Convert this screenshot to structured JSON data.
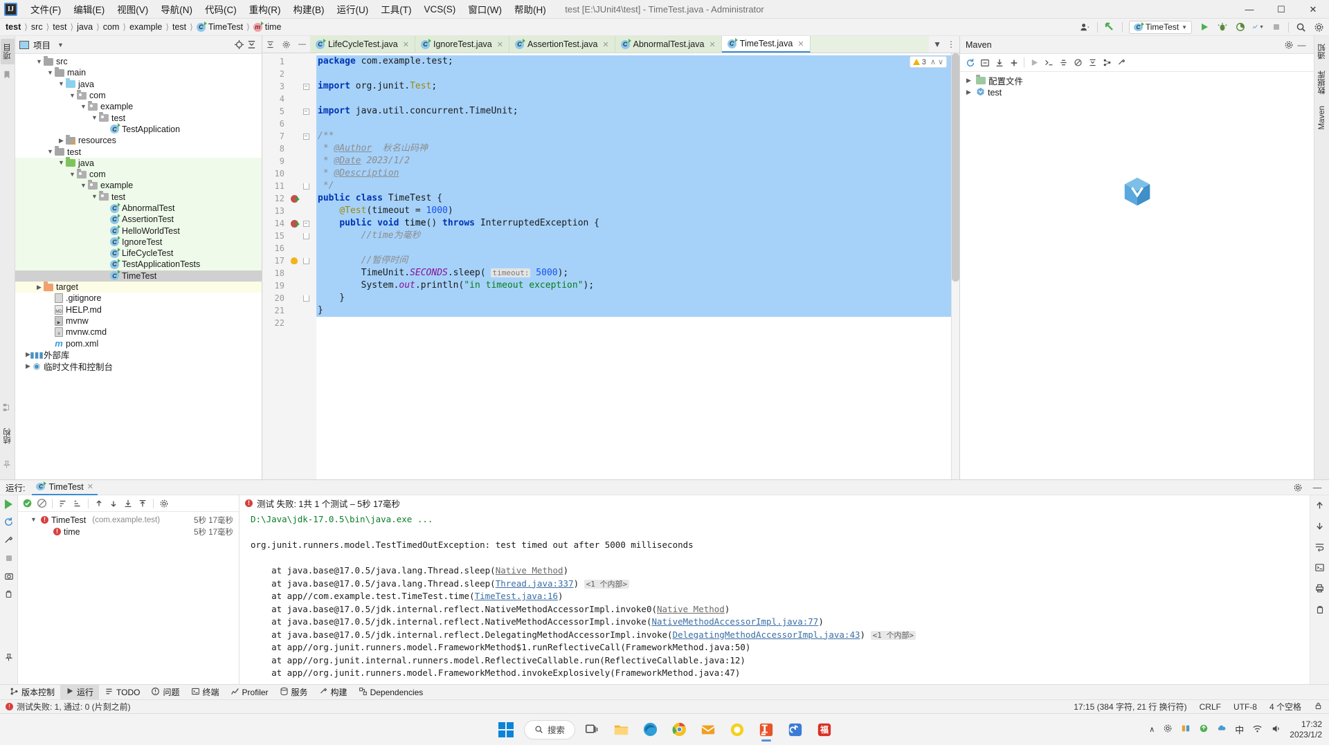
{
  "window": {
    "title": "test [E:\\JUnit4\\test] - TimeTest.java - Administrator",
    "logo": "IJ",
    "minimize": "—",
    "maximize": "☐",
    "close": "✕"
  },
  "menubar": [
    {
      "label": "文件(F)"
    },
    {
      "label": "编辑(E)"
    },
    {
      "label": "视图(V)"
    },
    {
      "label": "导航(N)"
    },
    {
      "label": "代码(C)"
    },
    {
      "label": "重构(R)"
    },
    {
      "label": "构建(B)"
    },
    {
      "label": "运行(U)"
    },
    {
      "label": "工具(T)"
    },
    {
      "label": "VCS(S)"
    },
    {
      "label": "窗口(W)"
    },
    {
      "label": "帮助(H)"
    }
  ],
  "breadcrumb": [
    {
      "label": "test",
      "bold": true
    },
    {
      "label": "src"
    },
    {
      "label": "test"
    },
    {
      "label": "java"
    },
    {
      "label": "com"
    },
    {
      "label": "example"
    },
    {
      "label": "test"
    },
    {
      "label": "TimeTest",
      "icon": "class-icon"
    },
    {
      "label": "time",
      "icon": "method-icon"
    }
  ],
  "toolbar_right": {
    "run_config": "TimeTest",
    "search_icon": "search-icon",
    "settings_icon": "gear-icon",
    "run_icon": "run-icon",
    "debug_icon": "debug-icon",
    "coverage_icon": "coverage-icon",
    "stop_icon": "stop-icon"
  },
  "project_panel": {
    "title": "项目",
    "locate_icon": "locate-icon",
    "collapse_icon": "collapse-all-icon",
    "settings_icon": "gear-icon",
    "hide_icon": "hide-icon",
    "tree": [
      {
        "label": "src",
        "indent": 1,
        "arrow": "v",
        "icon": "folder",
        "bg": ""
      },
      {
        "label": "main",
        "indent": 2,
        "arrow": "v",
        "icon": "folder",
        "bg": ""
      },
      {
        "label": "java",
        "indent": 3,
        "arrow": "v",
        "icon": "folder-blue",
        "bg": ""
      },
      {
        "label": "com",
        "indent": 4,
        "arrow": "v",
        "icon": "folder-pkg",
        "bg": ""
      },
      {
        "label": "example",
        "indent": 5,
        "arrow": "v",
        "icon": "folder-pkg",
        "bg": ""
      },
      {
        "label": "test",
        "indent": 6,
        "arrow": "v",
        "icon": "folder-pkg",
        "bg": ""
      },
      {
        "label": "TestApplication",
        "indent": 7,
        "arrow": "",
        "icon": "class",
        "bg": ""
      },
      {
        "label": "resources",
        "indent": 3,
        "arrow": ">",
        "icon": "folder-res",
        "bg": ""
      },
      {
        "label": "test",
        "indent": 2,
        "arrow": "v",
        "icon": "folder",
        "bg": ""
      },
      {
        "label": "java",
        "indent": 3,
        "arrow": "v",
        "icon": "folder-green",
        "bg": "green"
      },
      {
        "label": "com",
        "indent": 4,
        "arrow": "v",
        "icon": "folder-pkg",
        "bg": "green"
      },
      {
        "label": "example",
        "indent": 5,
        "arrow": "v",
        "icon": "folder-pkg",
        "bg": "green"
      },
      {
        "label": "test",
        "indent": 6,
        "arrow": "v",
        "icon": "folder-pkg",
        "bg": "green"
      },
      {
        "label": "AbnormalTest",
        "indent": 7,
        "arrow": "",
        "icon": "class",
        "bg": "green"
      },
      {
        "label": "AssertionTest",
        "indent": 7,
        "arrow": "",
        "icon": "class",
        "bg": "green"
      },
      {
        "label": "HelloWorldTest",
        "indent": 7,
        "arrow": "",
        "icon": "class",
        "bg": "green"
      },
      {
        "label": "IgnoreTest",
        "indent": 7,
        "arrow": "",
        "icon": "class",
        "bg": "green"
      },
      {
        "label": "LifeCycleTest",
        "indent": 7,
        "arrow": "",
        "icon": "class",
        "bg": "green"
      },
      {
        "label": "TestApplicationTests",
        "indent": 7,
        "arrow": "",
        "icon": "class",
        "bg": "green"
      },
      {
        "label": "TimeTest",
        "indent": 7,
        "arrow": "",
        "icon": "class",
        "bg": "sel"
      },
      {
        "label": "target",
        "indent": 1,
        "arrow": ">",
        "icon": "folder-orange",
        "bg": "yellow"
      },
      {
        "label": ".gitignore",
        "indent": 2,
        "arrow": "",
        "icon": "file-ignore",
        "bg": ""
      },
      {
        "label": "HELP.md",
        "indent": 2,
        "arrow": "",
        "icon": "file-md",
        "bg": ""
      },
      {
        "label": "mvnw",
        "indent": 2,
        "arrow": "",
        "icon": "file-run",
        "bg": ""
      },
      {
        "label": "mvnw.cmd",
        "indent": 2,
        "arrow": "",
        "icon": "file-cmd",
        "bg": ""
      },
      {
        "label": "pom.xml",
        "indent": 2,
        "arrow": "",
        "icon": "file-maven",
        "bg": ""
      },
      {
        "label": "外部库",
        "indent": 0,
        "arrow": ">",
        "icon": "file-lib",
        "bg": ""
      },
      {
        "label": "临时文件和控制台",
        "indent": 0,
        "arrow": ">",
        "icon": "file-console",
        "bg": ""
      }
    ]
  },
  "editor": {
    "tabs": [
      {
        "label": "LifeCycleTest.java",
        "active": false
      },
      {
        "label": "IgnoreTest.java",
        "active": false
      },
      {
        "label": "AssertionTest.java",
        "active": false
      },
      {
        "label": "AbnormalTest.java",
        "active": false
      },
      {
        "label": "TimeTest.java",
        "active": true
      }
    ],
    "inspection_badge": {
      "count": "3",
      "up": "∧",
      "down": "∨"
    },
    "lines": [
      {
        "n": 1,
        "sel": true,
        "mark": "",
        "fold": "",
        "html": "<span class='kw'>package</span> com.example.test;"
      },
      {
        "n": 2,
        "sel": true,
        "mark": "",
        "fold": "",
        "html": ""
      },
      {
        "n": 3,
        "sel": true,
        "mark": "",
        "fold": "-",
        "html": "<span class='kw'>import</span> org.junit.<span class='anno'>Test</span>;"
      },
      {
        "n": 4,
        "sel": true,
        "mark": "",
        "fold": "",
        "html": ""
      },
      {
        "n": 5,
        "sel": true,
        "mark": "",
        "fold": "-",
        "html": "<span class='kw'>import</span> java.util.concurrent.TimeUnit;"
      },
      {
        "n": 6,
        "sel": true,
        "mark": "",
        "fold": "",
        "html": ""
      },
      {
        "n": 7,
        "sel": true,
        "mark": "",
        "fold": "-",
        "html": "<span class='jdoc'>/**</span>"
      },
      {
        "n": 8,
        "sel": true,
        "mark": "",
        "fold": "",
        "html": "<span class='jdoc'> * </span><span class='jtag'>@Author</span><span class='jdoc'>  秋名山码神</span>"
      },
      {
        "n": 9,
        "sel": true,
        "mark": "",
        "fold": "",
        "html": "<span class='jdoc'> * </span><span class='jtag'>@Date</span><span class='jdoc'> 2023/1/2</span>"
      },
      {
        "n": 10,
        "sel": true,
        "mark": "",
        "fold": "",
        "html": "<span class='jdoc'> * </span><span class='jtag'>@Description</span>"
      },
      {
        "n": 11,
        "sel": true,
        "mark": "",
        "fold": "f",
        "html": "<span class='jdoc'> */</span>"
      },
      {
        "n": 12,
        "sel": true,
        "mark": "run",
        "fold": "",
        "html": "<span class='kw'>public class</span> TimeTest {"
      },
      {
        "n": 13,
        "sel": true,
        "mark": "",
        "fold": "",
        "html": "    <span class='anno'>@Test</span>(timeout = <span class='num'>1000</span>)"
      },
      {
        "n": 14,
        "sel": true,
        "mark": "run",
        "fold": "-",
        "html": "    <span class='kw'>public void</span> <span class='ident'>time</span>() <span class='kw'>throws</span> InterruptedException {"
      },
      {
        "n": 15,
        "sel": true,
        "mark": "",
        "fold": "f",
        "html": "        <span class='cmt'>//time为毫秒</span>"
      },
      {
        "n": 16,
        "sel": true,
        "mark": "",
        "fold": "",
        "html": ""
      },
      {
        "n": 17,
        "sel": true,
        "mark": "bulb",
        "fold": "f",
        "html": "        <span class='cmt'>//暂停时间</span>"
      },
      {
        "n": 18,
        "sel": true,
        "mark": "",
        "fold": "",
        "html": "        TimeUnit.<span class='fld'>SECONDS</span>.sleep( <span class='hint'>timeout:</span> <span class='num'>5000</span>);"
      },
      {
        "n": 19,
        "sel": true,
        "mark": "",
        "fold": "",
        "html": "        System.<span class='fld'>out</span>.println(<span class='str'>\"in timeout exception\"</span>);"
      },
      {
        "n": 20,
        "sel": true,
        "mark": "",
        "fold": "f",
        "html": "    }"
      },
      {
        "n": 21,
        "sel": true,
        "mark": "",
        "fold": "",
        "html": "}"
      },
      {
        "n": 22,
        "sel": false,
        "mark": "",
        "fold": "",
        "html": ""
      }
    ]
  },
  "maven_panel": {
    "title": "Maven",
    "settings_icon": "gear-icon",
    "minimize_icon": "minimize-icon",
    "toolbar_icons": [
      "refresh-icon",
      "add-icon",
      "download-icon",
      "plus-icon",
      "run-icon",
      "skip-tests-icon",
      "toggle-offline-icon",
      "show-dependencies-icon",
      "collapse-icon",
      "execute-goal-icon",
      "settings-icon"
    ],
    "tree": [
      {
        "label": "配置文件",
        "arrow": ">",
        "icon": "profiles-icon"
      },
      {
        "label": "test",
        "arrow": ">",
        "icon": "maven-project-icon"
      }
    ]
  },
  "run_panel": {
    "label": "运行:",
    "tab_label": "TimeTest",
    "settings_icon": "gear-icon",
    "minimize_icon": "minimize-icon",
    "close_icon": "close-icon",
    "status_text": "测试 失败: 1共 1 个测试 – 5秒 17毫秒",
    "toolbar_icons": [
      "rerun-icon",
      "pass-filter-icon",
      "ignore-filter-icon",
      "sort-icon",
      "expand-icon",
      "collapse-icon",
      "prev-icon",
      "next-icon",
      "import-icon",
      "export-icon",
      "settings-icon"
    ],
    "rail_icons": [
      "run-icon",
      "rerun-icon",
      "wrench-icon",
      "stop-icon",
      "camera-icon",
      "trash-icon",
      "pin-icon"
    ],
    "console_rail_icons": [
      "up-icon",
      "down-icon",
      "wrap-icon",
      "soft-wrap-icon",
      "print-icon",
      "clear-icon"
    ],
    "tree": [
      {
        "label": "TimeTest",
        "suffix": "(com.example.test)",
        "time": "5秒 17毫秒",
        "indent": 0,
        "arrow": "v"
      },
      {
        "label": "time",
        "suffix": "",
        "time": "5秒 17毫秒",
        "indent": 1,
        "arrow": ""
      }
    ],
    "console": [
      {
        "type": "cmd",
        "text": "D:\\Java\\jdk-17.0.5\\bin\\java.exe ..."
      },
      {
        "type": "blank",
        "text": ""
      },
      {
        "type": "plain",
        "text": "org.junit.runners.model.TestTimedOutException: test timed out after 5000 milliseconds"
      },
      {
        "type": "blank",
        "text": ""
      },
      {
        "type": "trace",
        "pre": "\tat java.base@17.0.5/java.lang.Thread.sleep(",
        "link": "Native Method",
        "linkgray": true,
        "post": ")",
        "badge": ""
      },
      {
        "type": "trace",
        "pre": "\tat java.base@17.0.5/java.lang.Thread.sleep(",
        "link": "Thread.java:337",
        "linkgray": false,
        "post": ")",
        "badge": "<1 个内部>"
      },
      {
        "type": "trace",
        "pre": "\tat app//com.example.test.TimeTest.time(",
        "link": "TimeTest.java:16",
        "linkgray": false,
        "post": ")",
        "badge": ""
      },
      {
        "type": "trace",
        "pre": "\tat java.base@17.0.5/jdk.internal.reflect.NativeMethodAccessorImpl.invoke0(",
        "link": "Native Method",
        "linkgray": true,
        "post": ")",
        "badge": ""
      },
      {
        "type": "trace",
        "pre": "\tat java.base@17.0.5/jdk.internal.reflect.NativeMethodAccessorImpl.invoke(",
        "link": "NativeMethodAccessorImpl.java:77",
        "linkgray": false,
        "post": ")",
        "badge": ""
      },
      {
        "type": "trace",
        "pre": "\tat java.base@17.0.5/jdk.internal.reflect.DelegatingMethodAccessorImpl.invoke(",
        "link": "DelegatingMethodAccessorImpl.java:43",
        "linkgray": false,
        "post": ")",
        "badge": "<1 个内部>"
      },
      {
        "type": "plain",
        "text": "\tat app//org.junit.runners.model.FrameworkMethod$1.runReflectiveCall(FrameworkMethod.java:50)"
      },
      {
        "type": "plain",
        "text": "\tat app//org.junit.internal.runners.model.ReflectiveCallable.run(ReflectiveCallable.java:12)"
      },
      {
        "type": "plain",
        "text": "\tat app//org.junit.runners.model.FrameworkMethod.invokeExplosively(FrameworkMethod.java:47)"
      }
    ]
  },
  "toolwindow_bar": [
    {
      "label": "版本控制",
      "icon": "vcs-icon",
      "active": false
    },
    {
      "label": "运行",
      "icon": "run-icon",
      "active": true
    },
    {
      "label": "TODO",
      "icon": "todo-icon",
      "active": false
    },
    {
      "label": "问题",
      "icon": "problems-icon",
      "active": false
    },
    {
      "label": "终端",
      "icon": "terminal-icon",
      "active": false
    },
    {
      "label": "Profiler",
      "icon": "profiler-icon",
      "active": false
    },
    {
      "label": "服务",
      "icon": "services-icon",
      "active": false
    },
    {
      "label": "构建",
      "icon": "build-icon",
      "active": false
    },
    {
      "label": "Dependencies",
      "icon": "dependencies-icon",
      "active": false
    }
  ],
  "left_rail": {
    "tabs": [
      {
        "label": "项目"
      }
    ],
    "icons": [
      "bookmark-icon",
      "structure-icon",
      "favorites-icon"
    ]
  },
  "right_rail": {
    "tabs": [
      {
        "label": "通知"
      },
      {
        "label": "数据库"
      },
      {
        "label": "Maven"
      }
    ]
  },
  "statusbar": {
    "error_text": "测试失败: 1, 通过: 0 (片刻之前)",
    "caret": "17:15 (384 字符, 21 行 换行符)",
    "line_sep": "CRLF",
    "encoding": "UTF-8",
    "indent": "4 个空格",
    "lock_icon": "lock-icon"
  },
  "taskbar": {
    "search_placeholder": "搜索",
    "search_icon": "search-icon",
    "apps": [
      {
        "name": "start-button",
        "glyph": ""
      },
      {
        "name": "taskview-icon",
        "glyph": "⬜"
      },
      {
        "name": "file-explorer-icon",
        "glyph": ""
      },
      {
        "name": "edge-icon",
        "glyph": ""
      },
      {
        "name": "chrome-icon",
        "glyph": ""
      },
      {
        "name": "mail-icon",
        "glyph": ""
      },
      {
        "name": "apps-icon",
        "glyph": ""
      },
      {
        "name": "intellij-icon",
        "glyph": "IJ"
      },
      {
        "name": "netease-icon",
        "glyph": ""
      },
      {
        "name": "fu-app-icon",
        "glyph": "福"
      }
    ],
    "tray": {
      "chevron": "∧",
      "icons": [
        "settings-icon",
        "network-icon",
        "update-icon",
        "cloud-icon",
        "ime-cn",
        "wifi-icon",
        "volume-icon"
      ],
      "ime": "中",
      "time": "17:32",
      "date": "2023/1/2"
    }
  }
}
